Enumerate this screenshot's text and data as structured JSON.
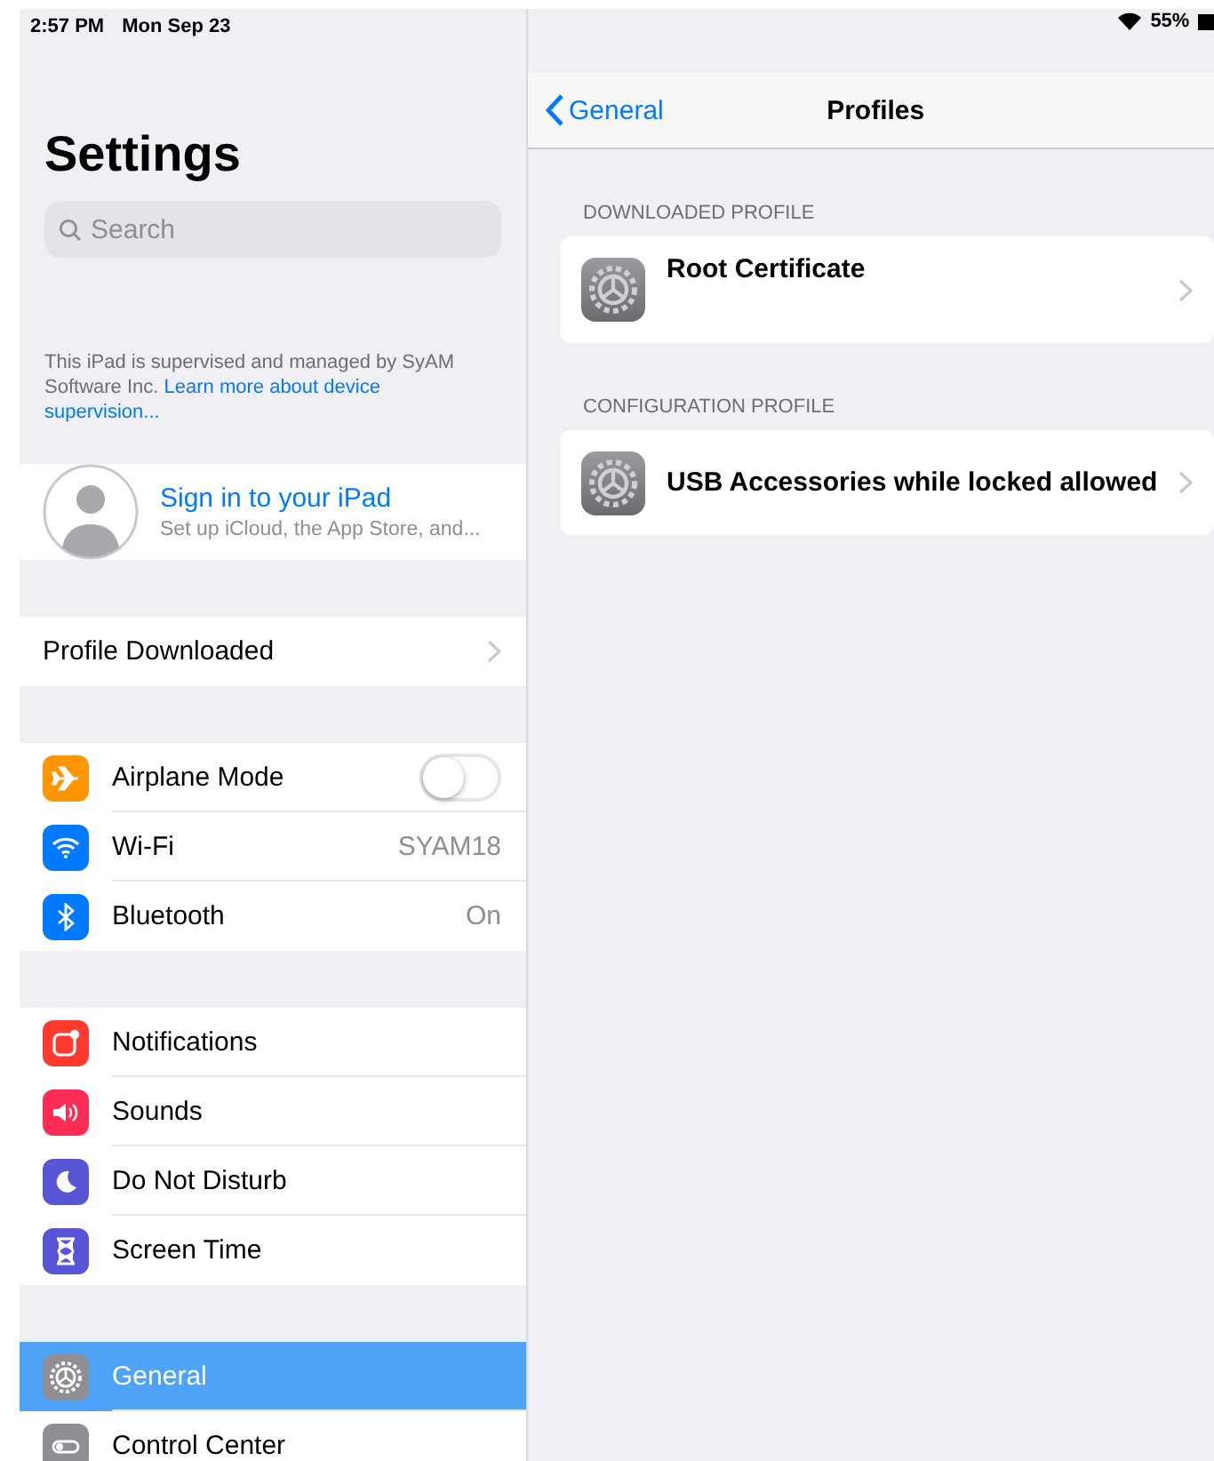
{
  "status_bar": {
    "time": "2:57 PM",
    "date": "Mon Sep 23",
    "battery": "55%"
  },
  "sidebar": {
    "title": "Settings",
    "search": {
      "placeholder": "Search"
    },
    "supervision_note": {
      "text": "This iPad is supervised and managed by SyAM Software Inc.",
      "link_lines": [
        "Learn more about device",
        "supervision..."
      ]
    },
    "account": {
      "title": "Sign in to your iPad",
      "subtitle": "Set up iCloud, the App Store, and..."
    },
    "groups": [
      {
        "items": [
          {
            "kind": "link",
            "label": "Profile Downloaded",
            "selected": false
          }
        ]
      },
      {
        "items": [
          {
            "kind": "toggle",
            "color": "#ff9500",
            "label": "Airplane Mode",
            "on": false,
            "selected": false
          },
          {
            "kind": "value",
            "color": "#007aff",
            "label": "Wi-Fi",
            "value": "SYAM18",
            "selected": false
          },
          {
            "kind": "value",
            "color": "#007aff",
            "label": "Bluetooth",
            "value": "On",
            "selected": false
          }
        ]
      },
      {
        "items": [
          {
            "kind": "plain",
            "color": "#ff3b30",
            "label": "Notifications",
            "selected": false
          },
          {
            "kind": "plain",
            "color": "#ff2d55",
            "label": "Sounds",
            "selected": false
          },
          {
            "kind": "plain",
            "color": "#5856d6",
            "label": "Do Not Disturb",
            "selected": false
          },
          {
            "kind": "plain",
            "color": "#5856d6",
            "label": "Screen Time",
            "selected": false
          }
        ]
      },
      {
        "items": [
          {
            "kind": "plain",
            "color": "#8e8e93",
            "label": "General",
            "selected": true
          },
          {
            "kind": "plain",
            "color": "#8e8e93",
            "label": "Control Center",
            "selected": false
          }
        ]
      }
    ]
  },
  "detail": {
    "back": "General",
    "title": "Profiles",
    "sections": [
      {
        "header": "DOWNLOADED PROFILE",
        "items": [
          {
            "label": "Root Certificate",
            "kind": "tall"
          }
        ]
      },
      {
        "header": "CONFIGURATION PROFILE",
        "items": [
          {
            "label": "USB Accessories while locked allowed",
            "kind": "short"
          }
        ]
      }
    ]
  }
}
